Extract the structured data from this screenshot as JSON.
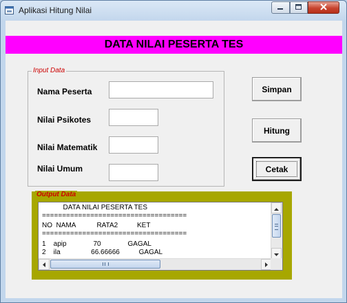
{
  "window": {
    "title": "Aplikasi Hitung Nilai",
    "controls": {
      "minimize": "minimize",
      "maximize": "maximize",
      "close": "close"
    }
  },
  "banner": {
    "text": "DATA NILAI PESERTA TES",
    "background": "#ff00ff"
  },
  "input_frame": {
    "legend": "Input Data",
    "fields": [
      {
        "label": "Nama Peserta",
        "value": ""
      },
      {
        "label": "Nilai Psikotes",
        "value": ""
      },
      {
        "label": "Nilai Matematik",
        "value": ""
      },
      {
        "label": "Nilai Umum",
        "value": ""
      }
    ]
  },
  "buttons": {
    "simpan": "Simpan",
    "hitung": "Hitung",
    "cetak": "Cetak"
  },
  "output_frame": {
    "legend": "Output Data",
    "background": "#a7a700",
    "lines": [
      "           DATA NILAI PESERTA TES",
      "====================================",
      "NO  NAMA           RATA2          KET",
      "====================================",
      "1    apip              70              GAGAL",
      "2    ila                66.66666          GAGAL"
    ]
  },
  "colors": {
    "legend_text": "#cc0000",
    "close_button": "#c8442f"
  }
}
